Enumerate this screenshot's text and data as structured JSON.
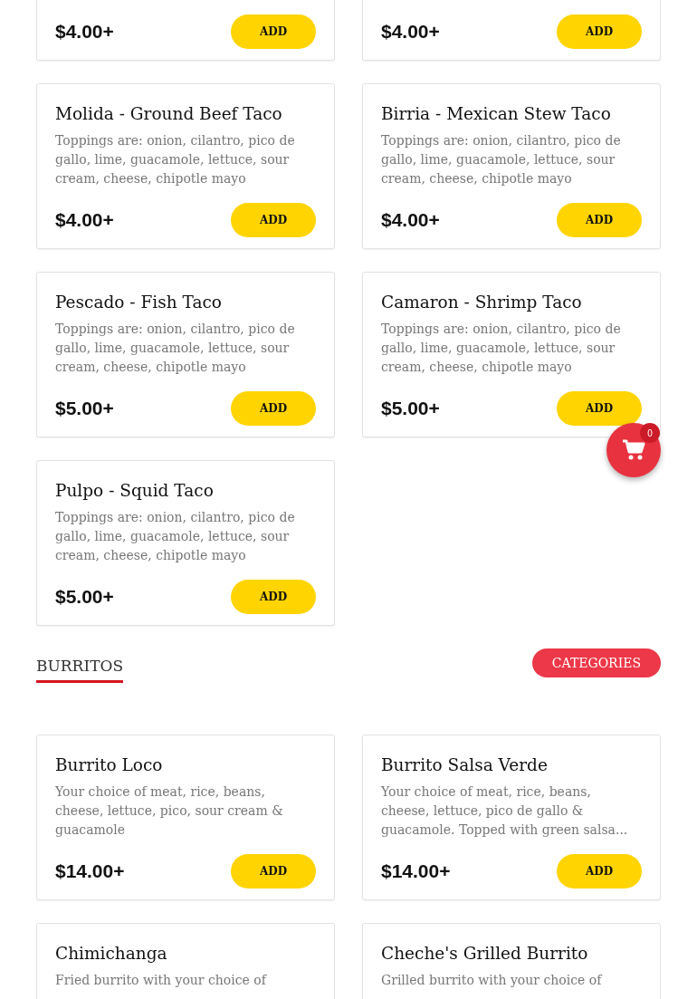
{
  "sections": [
    {
      "items": [
        {
          "price": "$4.00+",
          "button": "ADD"
        },
        {
          "price": "$4.00+",
          "button": "ADD"
        },
        {
          "name": "Molida - Ground Beef Taco",
          "description": "Toppings are: onion, cilantro, pico de gallo, lime, guacamole, lettuce, sour cream, cheese, chipotle mayo",
          "price": "$4.00+",
          "button": "ADD"
        },
        {
          "name": "Birria - Mexican Stew Taco",
          "description": "Toppings are: onion, cilantro, pico de gallo, lime, guacamole, lettuce, sour cream, cheese, chipotle mayo",
          "price": "$4.00+",
          "button": "ADD"
        },
        {
          "name": "Pescado - Fish Taco",
          "description": "Toppings are: onion, cilantro, pico de gallo, lime, guacamole, lettuce, sour cream, cheese, chipotle mayo",
          "price": "$5.00+",
          "button": "ADD"
        },
        {
          "name": "Camaron - Shrimp Taco",
          "description": "Toppings are: onion, cilantro, pico de gallo, lime, guacamole, lettuce, sour cream, cheese, chipotle mayo",
          "price": "$5.00+",
          "button": "ADD"
        },
        {
          "name": "Pulpo - Squid Taco",
          "description": "Toppings are: onion, cilantro, pico de gallo, lime, guacamole, lettuce, sour cream, cheese, chipotle mayo",
          "price": "$5.00+",
          "button": "ADD"
        }
      ]
    },
    {
      "title": "BURRITOS",
      "categories_button": "CATEGORIES",
      "items": [
        {
          "name": "Burrito Loco",
          "description": "Your choice of meat, rice, beans, cheese, lettuce, pico, sour cream & guacamole",
          "price": "$14.00+",
          "button": "ADD"
        },
        {
          "name": "Burrito Salsa Verde",
          "description": "Your choice of meat, rice, beans, cheese, lettuce, pico de gallo & guacamole. Topped with green salsa...",
          "price": "$14.00+",
          "button": "ADD"
        },
        {
          "name": "Chimichanga",
          "description": "Fried burrito with your choice of"
        },
        {
          "name": "Cheche's Grilled Burrito",
          "description": "Grilled burrito with your choice of"
        }
      ]
    }
  ],
  "cart": {
    "count": "0"
  }
}
